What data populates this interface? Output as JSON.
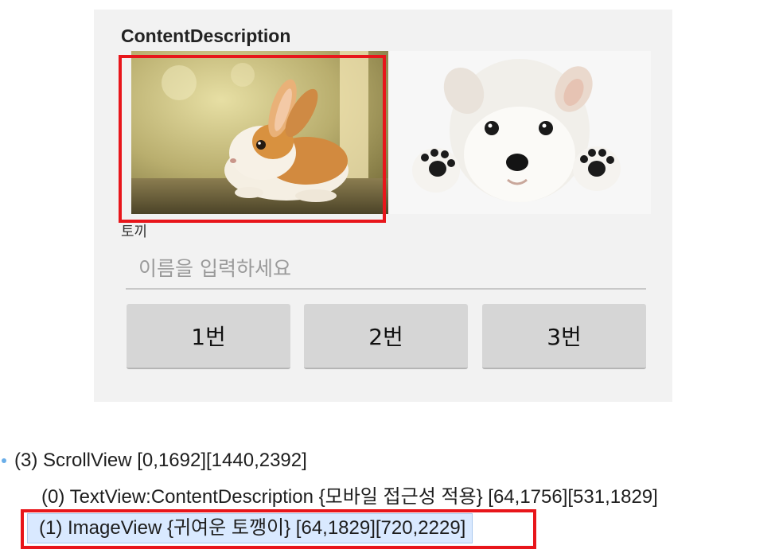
{
  "app": {
    "title": "ContentDescription",
    "images": [
      {
        "name": "rabbit-image",
        "description": "토끼"
      },
      {
        "name": "puppy-image"
      }
    ],
    "caption": "토끼",
    "input": {
      "placeholder": "이름을 입력하세요",
      "value": ""
    },
    "buttons": [
      "1번",
      "2번",
      "3번"
    ]
  },
  "hierarchy": {
    "rows": [
      {
        "text": "(3) ScrollView [0,1692][1440,2392]"
      },
      {
        "text": "(0) TextView:ContentDescription {모바일 접근성 적용} [64,1756][531,1829]"
      },
      {
        "text": "(1) ImageView {귀여운 토깽이} [64,1829][720,2229]",
        "selected": true
      }
    ]
  },
  "colors": {
    "highlight": "#e8161b",
    "selection": "#d9e9ff",
    "button": "#d6d6d6"
  }
}
